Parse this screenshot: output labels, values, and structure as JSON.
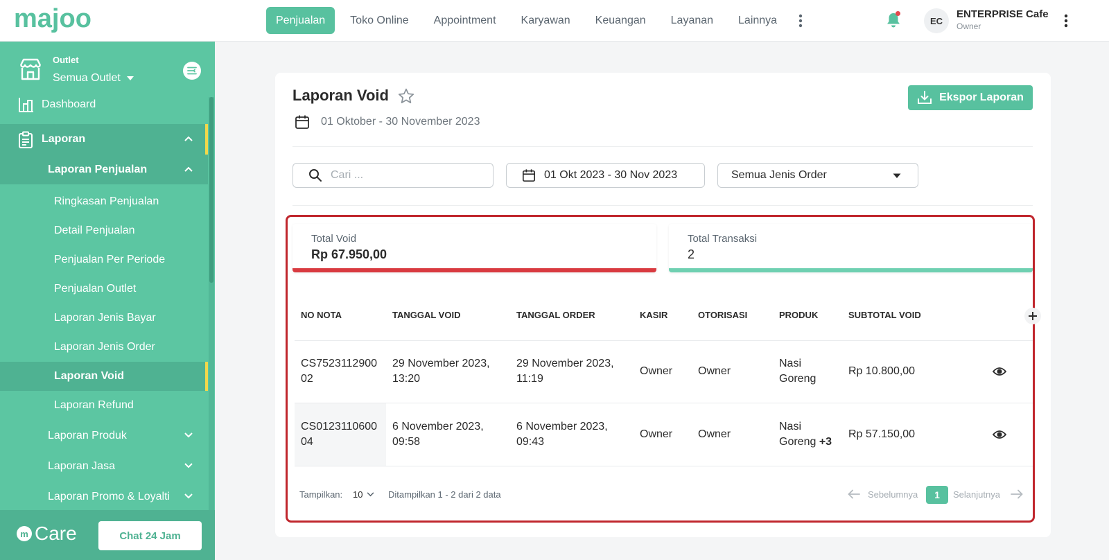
{
  "app": {
    "brand": "majoo",
    "colors": {
      "accent": "#58c19f",
      "sidebar": "#5cc6a2",
      "danger": "#d93a40",
      "active_indicator": "#f2d84a"
    }
  },
  "topnav": {
    "items": [
      "Penjualan",
      "Toko Online",
      "Appointment",
      "Karyawan",
      "Keuangan",
      "Layanan",
      "Lainnya"
    ],
    "active": "Penjualan"
  },
  "user": {
    "initials": "EC",
    "name": "ENTERPRISE Cafe",
    "role": "Owner"
  },
  "sidebar": {
    "outlet_label": "Outlet",
    "outlet_value": "Semua Outlet",
    "dashboard": "Dashboard",
    "laporan": "Laporan",
    "laporan_penjualan": "Laporan Penjualan",
    "sub_items": [
      "Ringkasan Penjualan",
      "Detail Penjualan",
      "Penjualan Per Periode",
      "Penjualan Outlet",
      "Laporan Jenis Bayar",
      "Laporan Jenis Order",
      "Laporan Void",
      "Laporan Refund"
    ],
    "active_sub": "Laporan Void",
    "groups": [
      "Laporan Produk",
      "Laporan Jasa",
      "Laporan Promo & Loyalti"
    ],
    "care_label": "Care",
    "chat_button": "Chat 24 Jam"
  },
  "page": {
    "title": "Laporan Void",
    "date_range": "01 Oktober - 30 November 2023",
    "export_button": "Ekspor Laporan",
    "search_placeholder": "Cari ...",
    "date_filter": "01 Okt 2023 - 30 Nov 2023",
    "order_filter": "Semua Jenis Order"
  },
  "summary": {
    "total_void_label": "Total Void",
    "total_void_value": "Rp 67.950,00",
    "total_trx_label": "Total Transaksi",
    "total_trx_value": "2"
  },
  "table": {
    "columns": [
      "NO NOTA",
      "TANGGAL VOID",
      "TANGGAL ORDER",
      "KASIR",
      "OTORISASI",
      "PRODUK",
      "SUBTOTAL VOID"
    ],
    "rows": [
      {
        "nota_1": "CS7523112900",
        "nota_2": "02",
        "void_1": "29 November 2023,",
        "void_2": "13:20",
        "order_1": "29 November 2023,",
        "order_2": "11:19",
        "kasir": "Owner",
        "otorisasi": "Owner",
        "produk_1": "Nasi",
        "produk_2": "Goreng",
        "produk_extra": "",
        "subtotal": "Rp 10.800,00"
      },
      {
        "nota_1": "CS0123110600",
        "nota_2": "04",
        "void_1": "6 November 2023,",
        "void_2": "09:58",
        "order_1": "6 November 2023,",
        "order_2": "09:43",
        "kasir": "Owner",
        "otorisasi": "Owner",
        "produk_1": "Nasi",
        "produk_2": "Goreng",
        "produk_extra": "+3",
        "subtotal": "Rp 57.150,00"
      }
    ]
  },
  "pagination": {
    "show_label": "Tampilkan:",
    "page_size": "10",
    "info": "Ditampilkan 1 - 2 dari 2 data",
    "prev": "Sebelumnya",
    "current": "1",
    "next": "Selanjutnya"
  }
}
